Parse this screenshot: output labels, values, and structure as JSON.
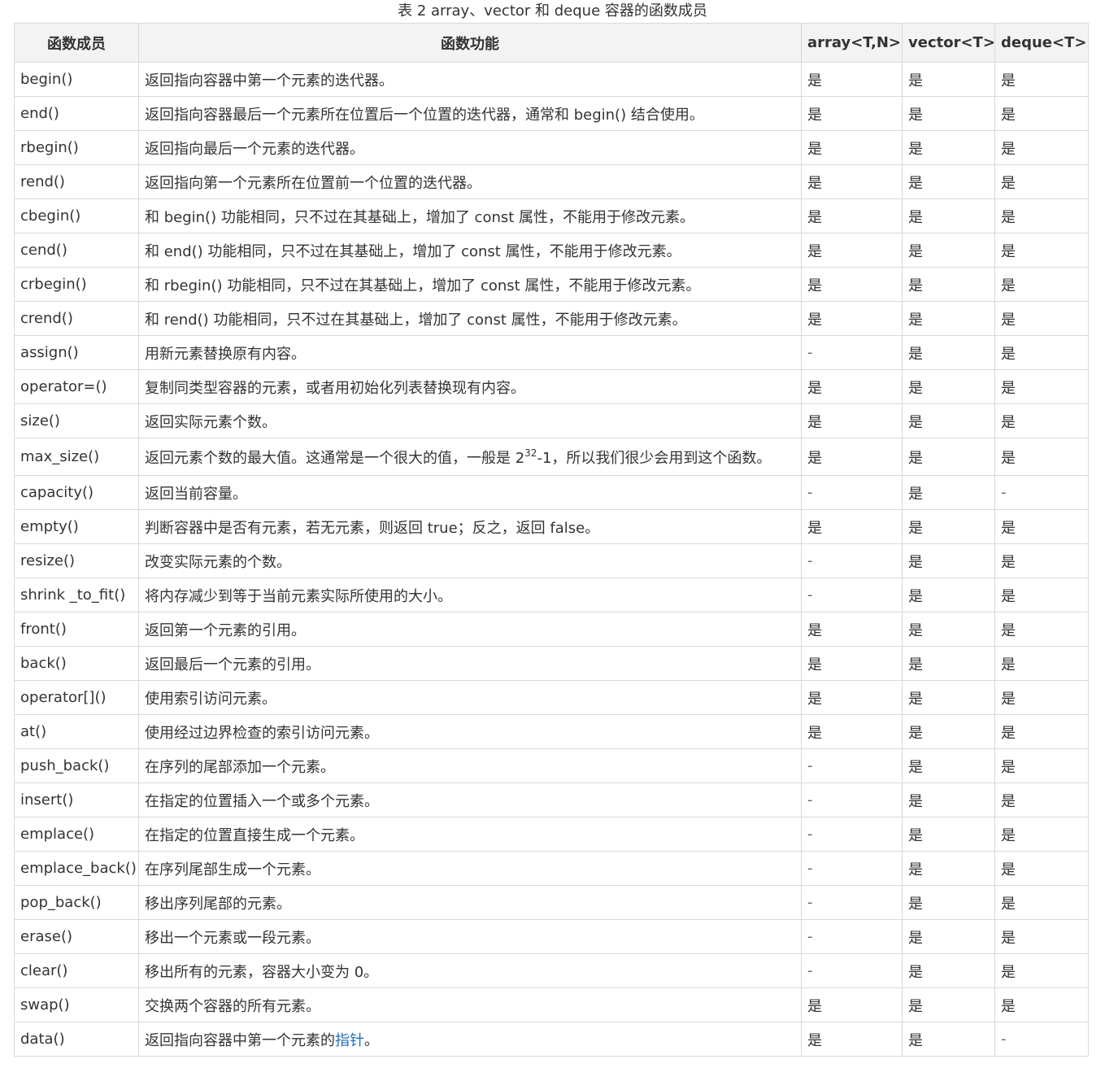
{
  "caption": "表 2 array、vector 和 deque 容器的函数成员",
  "headers": {
    "member": "函数成员",
    "function": "函数功能",
    "array": "array<T,N>",
    "vector": "vector<T>",
    "deque": "deque<T>"
  },
  "rows": [
    {
      "name": "begin()",
      "desc": "返回指向容器中第一个元素的迭代器。",
      "array": "是",
      "vector": "是",
      "deque": "是"
    },
    {
      "name": "end()",
      "desc": "返回指向容器最后一个元素所在位置后一个位置的迭代器，通常和 begin() 结合使用。",
      "array": "是",
      "vector": "是",
      "deque": "是"
    },
    {
      "name": "rbegin()",
      "desc": "返回指向最后一个元素的迭代器。",
      "array": "是",
      "vector": "是",
      "deque": "是"
    },
    {
      "name": "rend()",
      "desc": "返回指向第一个元素所在位置前一个位置的迭代器。",
      "array": "是",
      "vector": "是",
      "deque": "是"
    },
    {
      "name": "cbegin()",
      "desc": "和 begin() 功能相同，只不过在其基础上，增加了 const 属性，不能用于修改元素。",
      "array": "是",
      "vector": "是",
      "deque": "是"
    },
    {
      "name": "cend()",
      "desc": "和 end() 功能相同，只不过在其基础上，增加了 const 属性，不能用于修改元素。",
      "array": "是",
      "vector": "是",
      "deque": "是"
    },
    {
      "name": "crbegin()",
      "desc": "和 rbegin() 功能相同，只不过在其基础上，增加了 const 属性，不能用于修改元素。",
      "array": "是",
      "vector": "是",
      "deque": "是"
    },
    {
      "name": "crend()",
      "desc": "和 rend() 功能相同，只不过在其基础上，增加了 const 属性，不能用于修改元素。",
      "array": "是",
      "vector": "是",
      "deque": "是"
    },
    {
      "name": "assign()",
      "desc": "用新元素替换原有内容。",
      "array": "-",
      "vector": "是",
      "deque": "是"
    },
    {
      "name": "operator=()",
      "desc": "复制同类型容器的元素，或者用初始化列表替换现有内容。",
      "array": "是",
      "vector": "是",
      "deque": "是"
    },
    {
      "name": "size()",
      "desc": "返回实际元素个数。",
      "array": "是",
      "vector": "是",
      "deque": "是"
    },
    {
      "name": "max_size()",
      "desc_pre": "返回元素个数的最大值。这通常是一个很大的值，一般是 2",
      "desc_sup": "32",
      "desc_post": "-1，所以我们很少会用到这个函数。",
      "array": "是",
      "vector": "是",
      "deque": "是"
    },
    {
      "name": "capacity()",
      "desc": "返回当前容量。",
      "array": "-",
      "vector": "是",
      "deque": "-"
    },
    {
      "name": "empty()",
      "desc": "判断容器中是否有元素，若无元素，则返回 true；反之，返回 false。",
      "array": "是",
      "vector": "是",
      "deque": "是"
    },
    {
      "name": "resize()",
      "desc": "改变实际元素的个数。",
      "array": "-",
      "vector": "是",
      "deque": "是"
    },
    {
      "name": "shrink _to_fit()",
      "desc": "将内存减少到等于当前元素实际所使用的大小。",
      "array": "-",
      "vector": "是",
      "deque": "是"
    },
    {
      "name": "front()",
      "desc": "返回第一个元素的引用。",
      "array": "是",
      "vector": "是",
      "deque": "是"
    },
    {
      "name": "back()",
      "desc": "返回最后一个元素的引用。",
      "array": "是",
      "vector": "是",
      "deque": "是"
    },
    {
      "name": "operator[]()",
      "desc": "使用索引访问元素。",
      "array": "是",
      "vector": "是",
      "deque": "是"
    },
    {
      "name": "at()",
      "desc": "使用经过边界检查的索引访问元素。",
      "array": "是",
      "vector": "是",
      "deque": "是"
    },
    {
      "name": "push_back()",
      "desc": "在序列的尾部添加一个元素。",
      "array": "-",
      "vector": "是",
      "deque": "是"
    },
    {
      "name": "insert()",
      "desc": "在指定的位置插入一个或多个元素。",
      "array": "-",
      "vector": "是",
      "deque": "是"
    },
    {
      "name": "emplace()",
      "desc": "在指定的位置直接生成一个元素。",
      "array": "-",
      "vector": "是",
      "deque": "是"
    },
    {
      "name": "emplace_back()",
      "desc": "在序列尾部生成一个元素。",
      "array": "-",
      "vector": "是",
      "deque": "是"
    },
    {
      "name": "pop_back()",
      "desc": "移出序列尾部的元素。",
      "array": "-",
      "vector": "是",
      "deque": "是"
    },
    {
      "name": "erase()",
      "desc": "移出一个元素或一段元素。",
      "array": "-",
      "vector": "是",
      "deque": "是"
    },
    {
      "name": "clear()",
      "desc": "移出所有的元素，容器大小变为 0。",
      "array": "-",
      "vector": "是",
      "deque": "是"
    },
    {
      "name": "swap()",
      "desc": "交换两个容器的所有元素。",
      "array": "是",
      "vector": "是",
      "deque": "是"
    },
    {
      "name": "data()",
      "desc_pre": "返回指向容器中第一个元素的",
      "desc_link": "指针",
      "desc_post": "。",
      "array": "是",
      "vector": "是",
      "deque": "-"
    }
  ],
  "colors": {
    "header_bg": "#f3f3f3",
    "border": "#d9d9d9",
    "text": "#333333",
    "link": "#1e6fb8"
  }
}
